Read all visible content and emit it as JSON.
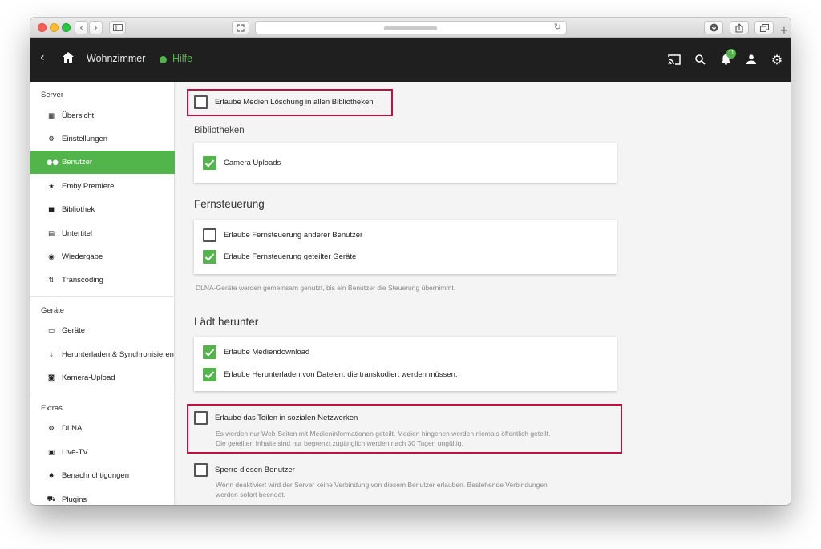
{
  "browser": {
    "reload_icon": "reload-icon",
    "add_tab": "+"
  },
  "appbar": {
    "title": "Wohnzimmer",
    "help": "Hilfe",
    "notification_count": "11",
    "accent": "#52b54b",
    "background": "#1f1f1f"
  },
  "sidebar": {
    "sections": [
      {
        "heading": "Server",
        "items": [
          {
            "label": "Übersicht",
            "icon": "dashboard-icon",
            "active": false
          },
          {
            "label": "Einstellungen",
            "icon": "gear-icon",
            "active": false
          },
          {
            "label": "Benutzer",
            "icon": "users-icon",
            "active": true
          },
          {
            "label": "Emby Premiere",
            "icon": "star-icon",
            "active": false
          },
          {
            "label": "Bibliothek",
            "icon": "folder-icon",
            "active": false
          },
          {
            "label": "Untertitel",
            "icon": "subtitles-icon",
            "active": false
          },
          {
            "label": "Wiedergabe",
            "icon": "play-circle-icon",
            "active": false
          },
          {
            "label": "Transcoding",
            "icon": "transcode-icon",
            "active": false
          }
        ]
      },
      {
        "heading": "Geräte",
        "items": [
          {
            "label": "Geräte",
            "icon": "tablet-icon",
            "active": false
          },
          {
            "label": "Herunterladen & Synchronisieren",
            "icon": "download-icon",
            "active": false
          },
          {
            "label": "Kamera-Upload",
            "icon": "camera-icon",
            "active": false
          }
        ]
      },
      {
        "heading": "Extras",
        "items": [
          {
            "label": "DLNA",
            "icon": "gear-icon",
            "active": false
          },
          {
            "label": "Live-TV",
            "icon": "tv-icon",
            "active": false
          },
          {
            "label": "Benachrichtigungen",
            "icon": "bell-icon",
            "active": false
          },
          {
            "label": "Plugins",
            "icon": "cart-icon",
            "active": false
          }
        ]
      }
    ]
  },
  "main": {
    "allow_delete_all": {
      "label": "Erlaube Medien Löschung in allen Bibliotheken",
      "checked": false
    },
    "libraries": {
      "title": "Bibliotheken",
      "items": [
        {
          "label": "Camera Uploads",
          "checked": true
        }
      ]
    },
    "remote": {
      "title": "Fernsteuerung",
      "items": [
        {
          "label": "Erlaube Fernsteuerung anderer Benutzer",
          "checked": false
        },
        {
          "label": "Erlaube Fernsteuerung geteilter Geräte",
          "checked": true
        }
      ],
      "note": "DLNA-Geräte werden gemeinsam genutzt, bis ein Benutzer die Steuerung übernimmt."
    },
    "downloads": {
      "title": "Lädt herunter",
      "items": [
        {
          "label": "Erlaube Mediendownload",
          "checked": true
        },
        {
          "label": "Erlaube Herunterladen von Dateien, die transkodiert werden müssen.",
          "checked": true
        }
      ]
    },
    "social": {
      "label": "Erlaube das Teilen in sozialen Netzwerken",
      "checked": false,
      "desc_line1": "Es werden nur Web-Seiten mit Medieninformationen geteilt. Medien hingenen werden niemals öffentlich geteilt.",
      "desc_line2": "Die geteilten Inhalte sind nur begrenzt zugänglich werden nach 30 Tagen ungültig."
    },
    "lock": {
      "label": "Sperre diesen Benutzer",
      "checked": false,
      "desc_line1": "Wenn deaktiviert wird der Server keine Verbindung von diesem Benutzer erlauben. Bestehende Verbindungen",
      "desc_line2": "werden sofort beendet."
    },
    "highlight_color": "#c0103d"
  }
}
